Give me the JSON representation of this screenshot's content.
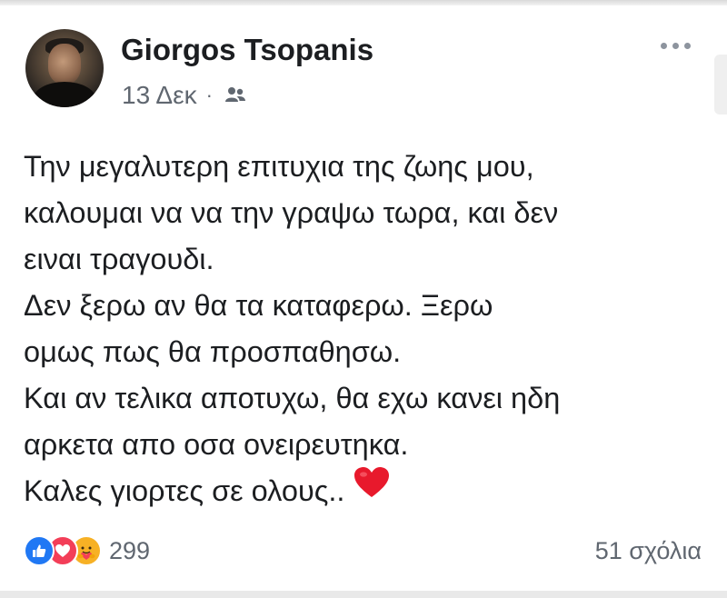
{
  "post": {
    "author": {
      "name": "Giorgos Tsopanis"
    },
    "meta": {
      "date": "13 Δεκ",
      "separator": "·",
      "audience_icon": "friends-icon"
    },
    "more_icon": "more-horizontal-icon",
    "body_lines": [
      "Την μεγαλυτερη επιτυχια της ζωης μου,",
      "καλουμαι να να την γραψω τωρα, και δεν",
      "ειναι τραγουδι.",
      "Δεν ξερω αν θα τα καταφερω. Ξερω",
      "ομως πως θα προσπαθησω.",
      "Και αν τελικα αποτυχω, θα εχω κανει ηδη",
      "αρκετα απο οσα ονειρευτηκα.",
      "Καλες γιορτες σε ολους.."
    ],
    "body_emoji": "red-heart-icon",
    "reactions": {
      "icons": [
        "like-icon",
        "love-icon",
        "care-icon"
      ],
      "count": "299"
    },
    "comments": {
      "label": "51 σχόλια"
    }
  },
  "colors": {
    "text": "#1c1e21",
    "secondary_text": "#606770",
    "like": "#2078f4",
    "love": "#f33e58",
    "care": "#f7b125",
    "heart": "#e8192c"
  }
}
